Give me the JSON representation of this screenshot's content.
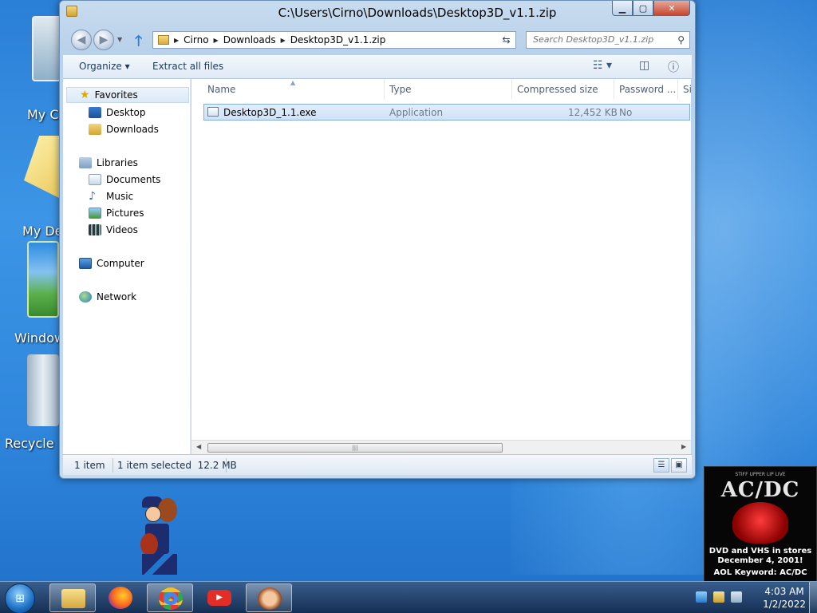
{
  "window": {
    "title": "C:\\Users\\Cirno\\Downloads\\Desktop3D_v1.1.zip",
    "minimize": "▁",
    "maximize": "▢",
    "close": "✕"
  },
  "address": {
    "crumbs": [
      "Cirno",
      "Downloads",
      "Desktop3D_v1.1.zip"
    ]
  },
  "search": {
    "placeholder": "Search Desktop3D_v1.1.zip"
  },
  "toolbar": {
    "organize": "Organize ▾",
    "extract": "Extract all files"
  },
  "sidebar": {
    "favorites": "Favorites",
    "desktop": "Desktop",
    "downloads": "Downloads",
    "libraries": "Libraries",
    "documents": "Documents",
    "music": "Music",
    "pictures": "Pictures",
    "videos": "Videos",
    "computer": "Computer",
    "network": "Network"
  },
  "columns": {
    "name": "Name",
    "type": "Type",
    "compressed": "Compressed size",
    "password": "Password ...",
    "size": "Si"
  },
  "files": [
    {
      "name": "Desktop3D_1.1.exe",
      "type": "Application",
      "compressed": "12,452 KB",
      "password": "No"
    }
  ],
  "status": {
    "count": "1 item",
    "selected": "1 item selected  12.2 MB"
  },
  "desktop_icons": {
    "my_computer": "My C",
    "my_documents": "My De",
    "windows": "Window",
    "recycle": "Recycle"
  },
  "ad": {
    "tagline": "STIFF UPPER LIP LIVE",
    "logo": "AC/DC",
    "line1": "DVD and VHS in stores",
    "line2": "December 4, 2001!",
    "keyword": "AOL Keyword: AC/DC"
  },
  "clock": {
    "time": "4:03 AM",
    "date": "1/2/2022"
  },
  "colors": {
    "accent": "#2d7dd8",
    "selection": "#cfe2f8",
    "desktop": "#2f86dc"
  }
}
